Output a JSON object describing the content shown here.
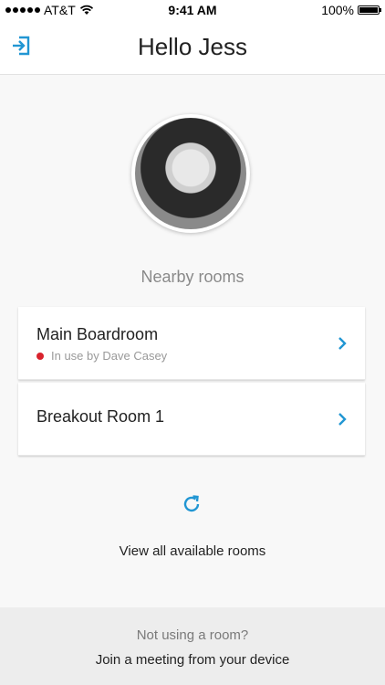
{
  "status_bar": {
    "carrier": "AT&T",
    "time": "9:41 AM",
    "battery_text": "100%",
    "battery_level": 1.0,
    "signal_icon": "signal-dots-icon",
    "wifi_icon": "wifi-icon",
    "battery_icon": "battery-icon"
  },
  "header": {
    "title": "Hello Jess",
    "left_icon": "logout-icon"
  },
  "profile": {
    "avatar": "user-avatar-photo"
  },
  "nearby": {
    "label": "Nearby rooms",
    "rooms": [
      {
        "name": "Main Boardroom",
        "status": "In use by Dave Casey",
        "status_color": "#d9232d"
      },
      {
        "name": "Breakout Room 1",
        "status": ""
      }
    ]
  },
  "actions": {
    "refresh_icon": "refresh-icon",
    "view_all": "View all available rooms"
  },
  "footer": {
    "question": "Not using a room?",
    "join": "Join a meeting from your device"
  },
  "colors": {
    "accent": "#2196d3",
    "busy": "#d9232d",
    "background": "#f8f8f8",
    "footer_bg": "#ededed"
  }
}
